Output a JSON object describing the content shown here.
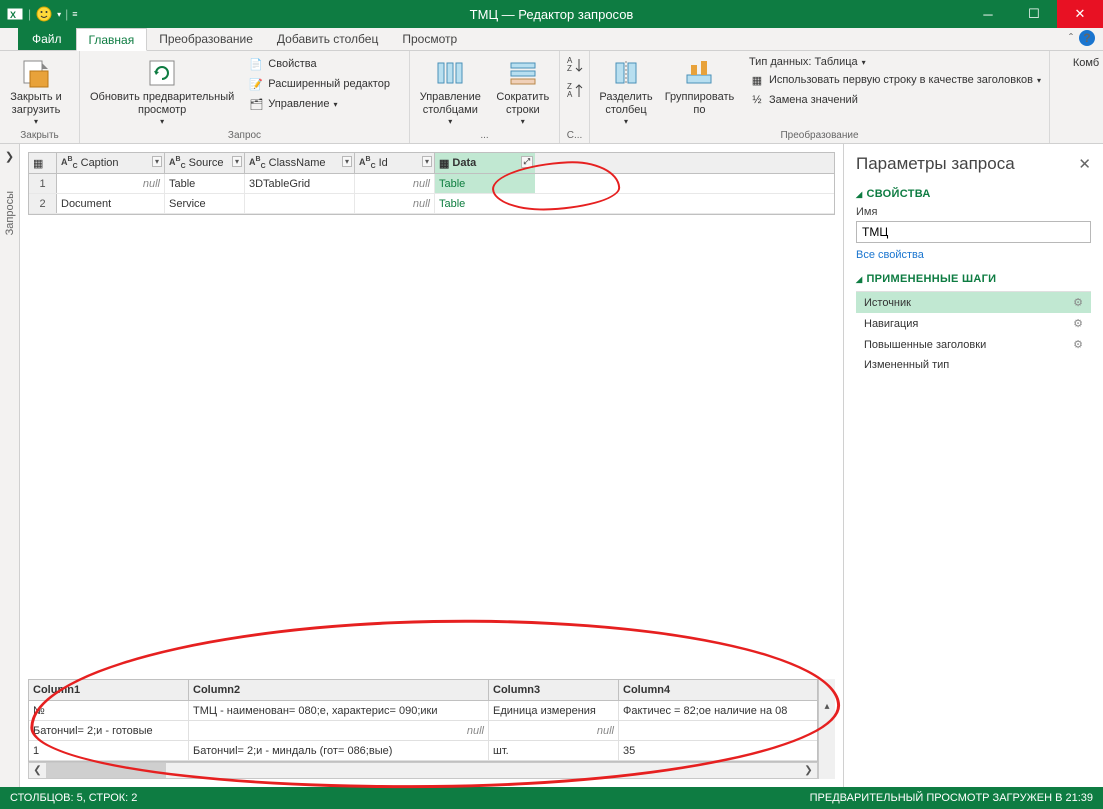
{
  "window": {
    "title": "ТМЦ — Редактор запросов"
  },
  "tabs": {
    "file": "Файл",
    "home": "Главная",
    "transform": "Преобразование",
    "addcol": "Добавить столбец",
    "view": "Просмотр"
  },
  "ribbon": {
    "close_group": "Закрыть",
    "close_load": "Закрыть и\nзагрузить",
    "query_group": "Запрос",
    "refresh": "Обновить предварительный\nпросмотр",
    "properties": "Свойства",
    "adv_editor": "Расширенный редактор",
    "manage": "Управление",
    "cols_group": "...",
    "manage_cols": "Управление\nстолбцами",
    "reduce_rows": "Сократить\nстроки",
    "sort_group": "С...",
    "split_col": "Разделить\nстолбец",
    "group_by": "Группировать\nпо",
    "transform_group": "Преобразование",
    "datatype": "Тип данных: Таблица",
    "first_row": "Использовать первую строку в качестве заголовков",
    "replace": "Замена значений",
    "combine": "Комб"
  },
  "siderail": {
    "label": "Запросы"
  },
  "grid_top": {
    "cols": [
      "Caption",
      "Source",
      "ClassName",
      "Id",
      "Data"
    ],
    "rows": [
      {
        "n": "1",
        "Caption": "null",
        "Source": "Table",
        "ClassName": "3DTableGrid",
        "Id": "null",
        "Data": "Table",
        "selData": true
      },
      {
        "n": "2",
        "Caption": "Document",
        "Source": "Service",
        "ClassName": "",
        "Id": "null",
        "Data": "Table"
      }
    ]
  },
  "grid_bottom": {
    "cols": [
      "Column1",
      "Column2",
      "Column3",
      "Column4"
    ],
    "rows": [
      [
        "№",
        "ТМЦ - наименован= 080;е, характерис= 090;ики",
        "Единица измерения",
        "Фактичес = 82;ое наличие на 08"
      ],
      [
        "Батончиl= 2;и - готовые",
        "null",
        "null",
        ""
      ],
      [
        "1",
        "Батончиl= 2;и - миндаль  (гот= 086;вые)",
        "шт.",
        "35"
      ]
    ]
  },
  "panel": {
    "title": "Параметры запроса",
    "props": "СВОЙСТВА",
    "name_label": "Имя",
    "name_value": "ТМЦ",
    "all_props": "Все свойства",
    "steps_h": "ПРИМЕНЕННЫЕ ШАГИ",
    "steps": [
      "Источник",
      "Навигация",
      "Повышенные заголовки",
      "Измененный тип"
    ]
  },
  "status": {
    "left": "СТОЛБЦОВ: 5, СТРОК: 2",
    "right": "ПРЕДВАРИТЕЛЬНЫЙ ПРОСМОТР ЗАГРУЖЕН В 21:39"
  }
}
